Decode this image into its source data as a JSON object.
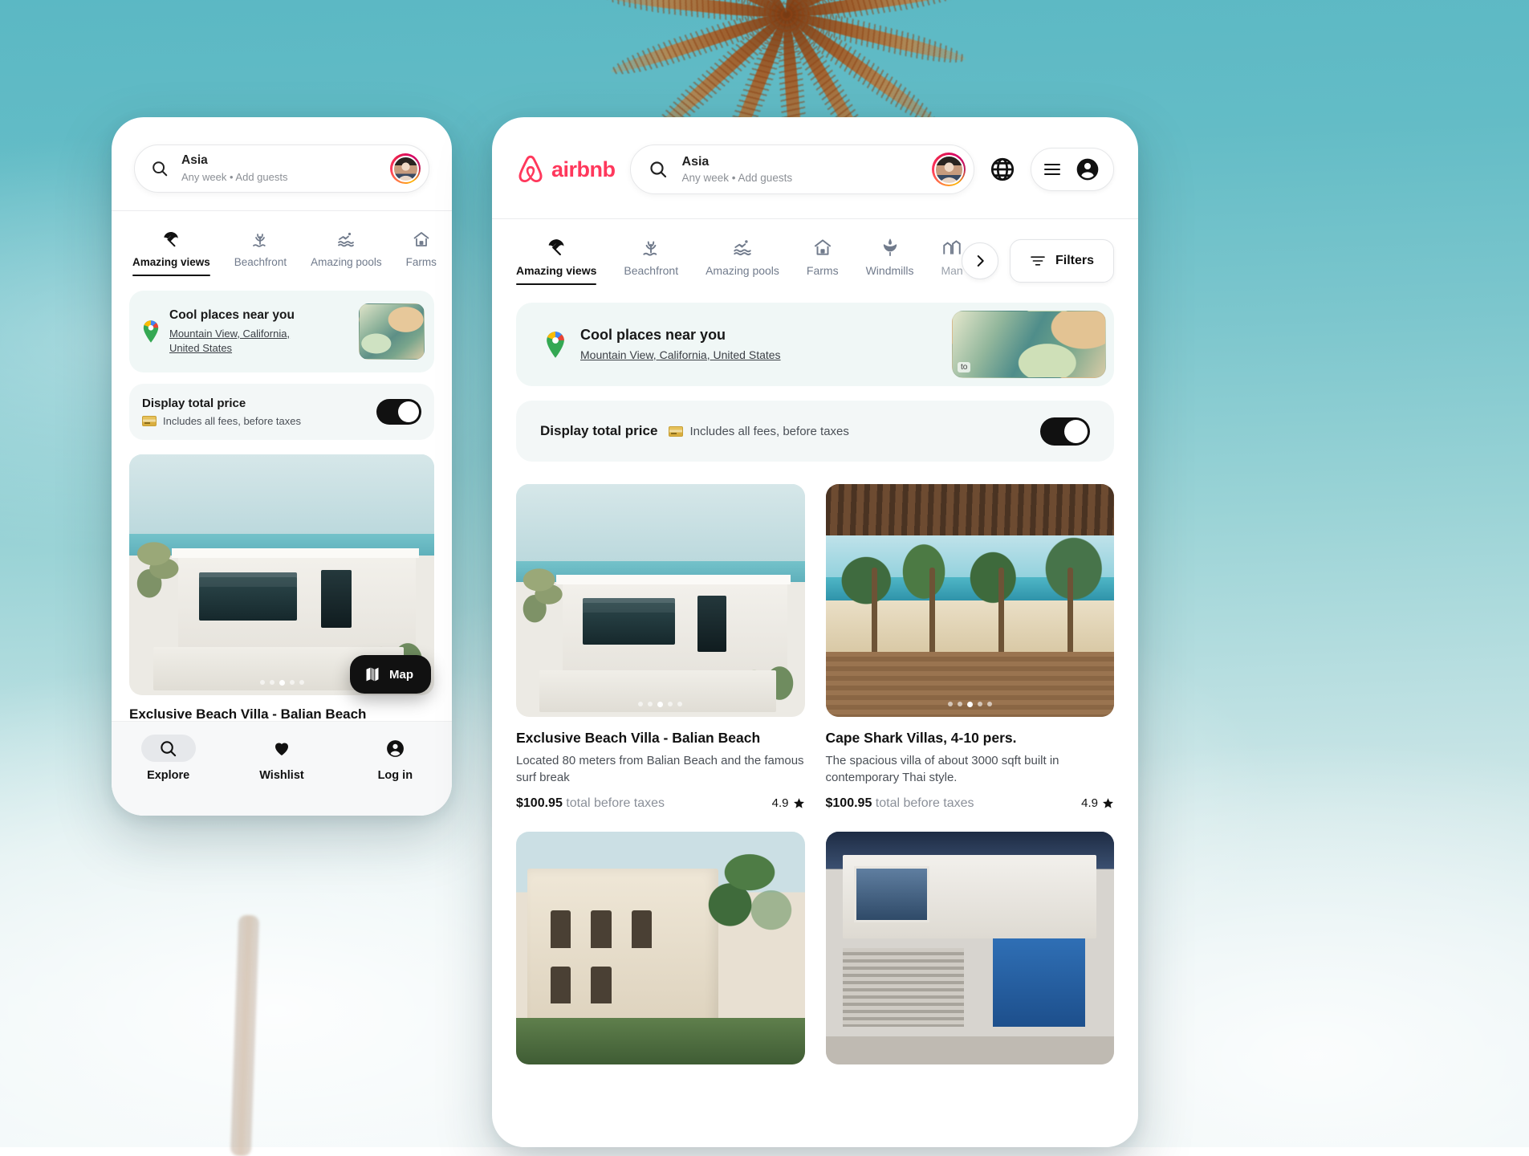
{
  "brand": {
    "name": "airbnb",
    "accent": "#FF385C",
    "logo_icon": "airbnb-logo-icon"
  },
  "search": {
    "query": "Asia",
    "subtitle": "Any week • Add guests",
    "icon": "search-icon",
    "avatar": "user-avatar"
  },
  "header_actions": {
    "globe": "globe-icon",
    "menu": "hamburger-icon",
    "account": "user-circle-icon"
  },
  "categories": [
    {
      "label": "Amazing views",
      "icon": "beach-umbrella-icon",
      "active": true
    },
    {
      "label": "Beachfront",
      "icon": "beach-grass-icon",
      "active": false
    },
    {
      "label": "Amazing pools",
      "icon": "swimmer-icon",
      "active": false
    },
    {
      "label": "Farms",
      "icon": "barn-icon",
      "active": false
    },
    {
      "label": "Windmills",
      "icon": "windmill-icon",
      "active": false
    },
    {
      "label": "Man",
      "icon": "mansion-icon",
      "active": false
    }
  ],
  "categories_mobile": [
    {
      "label": "Amazing views",
      "icon": "beach-umbrella-icon",
      "active": true
    },
    {
      "label": "Beachfront",
      "icon": "beach-grass-icon",
      "active": false
    },
    {
      "label": "Amazing pools",
      "icon": "swimmer-icon",
      "active": false
    },
    {
      "label": "Farms",
      "icon": "barn-icon",
      "active": false
    }
  ],
  "toolbar": {
    "filters_label": "Filters",
    "filters_icon": "filter-icon",
    "next_arrow_icon": "chevron-right-icon"
  },
  "cool_places": {
    "title": "Cool places near you",
    "location": "Mountain View, California, United States",
    "location_line1": "Mountain View, California,",
    "location_line2": "United States",
    "pin_icon": "google-maps-pin-icon",
    "map_thumb_label": "to"
  },
  "total_price": {
    "title": "Display total price",
    "subtitle": "Includes all fees, before taxes",
    "card_icon": "credit-card-icon",
    "toggle_on": true
  },
  "listings": [
    {
      "title": "Exclusive Beach Villa - Balian Beach",
      "description": "Located 80 meters from Balian Beach and the famous surf break",
      "price": "$100.95",
      "price_note": "total before taxes",
      "rating": "4.9",
      "star_icon": "star-icon",
      "photo": "beach-villa-photo",
      "dots": 5,
      "active_dot": 2
    },
    {
      "title": "Cape Shark Villas, 4-10 pers.",
      "description": "The spacious villa of about 3000 sqft built in contemporary Thai style.",
      "price": "$100.95",
      "price_note": "total before taxes",
      "rating": "4.9",
      "star_icon": "star-icon",
      "photo": "cape-shark-villas-photo",
      "dots": 5,
      "active_dot": 2
    },
    {
      "title": "",
      "description": "",
      "price": "",
      "price_note": "",
      "rating": "",
      "photo": "mansion-photo",
      "dots": 0,
      "active_dot": 0
    },
    {
      "title": "",
      "description": "",
      "price": "",
      "price_note": "",
      "rating": "",
      "photo": "modern-house-photo",
      "dots": 0,
      "active_dot": 0
    }
  ],
  "mobile_listing": {
    "title": "Exclusive Beach Villa - Balian Beach",
    "description": "Located 80 meters from Balian Beach and the famous surf break"
  },
  "map_button": {
    "label": "Map",
    "icon": "map-icon"
  },
  "bottom_nav": [
    {
      "label": "Explore",
      "icon": "search-icon",
      "selected": true
    },
    {
      "label": "Wishlist",
      "icon": "heart-icon",
      "selected": false
    },
    {
      "label": "Log in",
      "icon": "account-circle-icon",
      "selected": false
    }
  ]
}
